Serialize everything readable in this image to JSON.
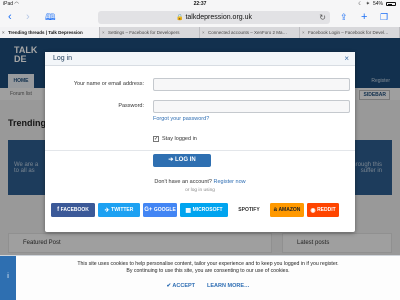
{
  "status_bar": {
    "device": "iPad",
    "wifi": "◠",
    "time": "22:37",
    "battery_pct": "54%",
    "bluetooth": "✶",
    "moon": "☾",
    "battery_level": 0.54
  },
  "browser": {
    "url": "talkdepression.org.uk",
    "tabs": [
      {
        "label": "Trending threads | Talk Depression",
        "active": true
      },
      {
        "label": "Settings – Facebook for Developers",
        "active": false
      },
      {
        "label": "Connected accounts – XenForo 2 Ma…",
        "active": false
      },
      {
        "label": "Facebook Login – Facebook for Devel…",
        "active": false
      }
    ]
  },
  "page": {
    "logo_line1": "TALK",
    "logo_line2": "DE",
    "nav_home": "HOME",
    "register": "Register",
    "forum_list": "Forum list",
    "sidebar": "SIDEBAR",
    "trending": "Trending",
    "intro_left": "We are a",
    "intro_left2": "to all as",
    "intro_right": "through this",
    "intro_right2": "suffer in",
    "featured": "Featured Post",
    "latest": "Latest posts"
  },
  "modal": {
    "title": "Log in",
    "close": "×",
    "username_label": "Your name or email address:",
    "username_value": "",
    "password_label": "Password:",
    "password_value": "",
    "forgot": "Forgot your password?",
    "stay_logged": "Stay logged in",
    "stay_checked": "✓",
    "login_button": "LOG IN",
    "no_account": "Don't have an account?",
    "register_now": "Register now",
    "or_log_in": "or log in using",
    "social": [
      {
        "label": "FACEBOOK",
        "icon": "f",
        "color": "#3b5998"
      },
      {
        "label": "TWITTER",
        "icon": "✈",
        "color": "#1da1f2"
      },
      {
        "label": "GOOGLE",
        "icon": "G+",
        "color": "#4285f4"
      },
      {
        "label": "MICROSOFT",
        "icon": "▦",
        "color": "#00a4ef"
      },
      {
        "label": "SPOTIFY",
        "icon": "",
        "color": "#ffffff",
        "text_color": "#333333"
      },
      {
        "label": "AMAZON",
        "icon": "a",
        "color": "#ff9900",
        "text_color": "#222222"
      },
      {
        "label": "REDDIT",
        "icon": "◉",
        "color": "#ff4500"
      }
    ]
  },
  "cookie": {
    "text1": "This site uses cookies to help personalise content, tailor your experience and to keep you logged in if you register.",
    "text2": "By continuing to use this site, you are consenting to our use of cookies.",
    "accept": "ACCEPT",
    "learn_more": "LEARN MORE…",
    "info_icon": "i"
  }
}
